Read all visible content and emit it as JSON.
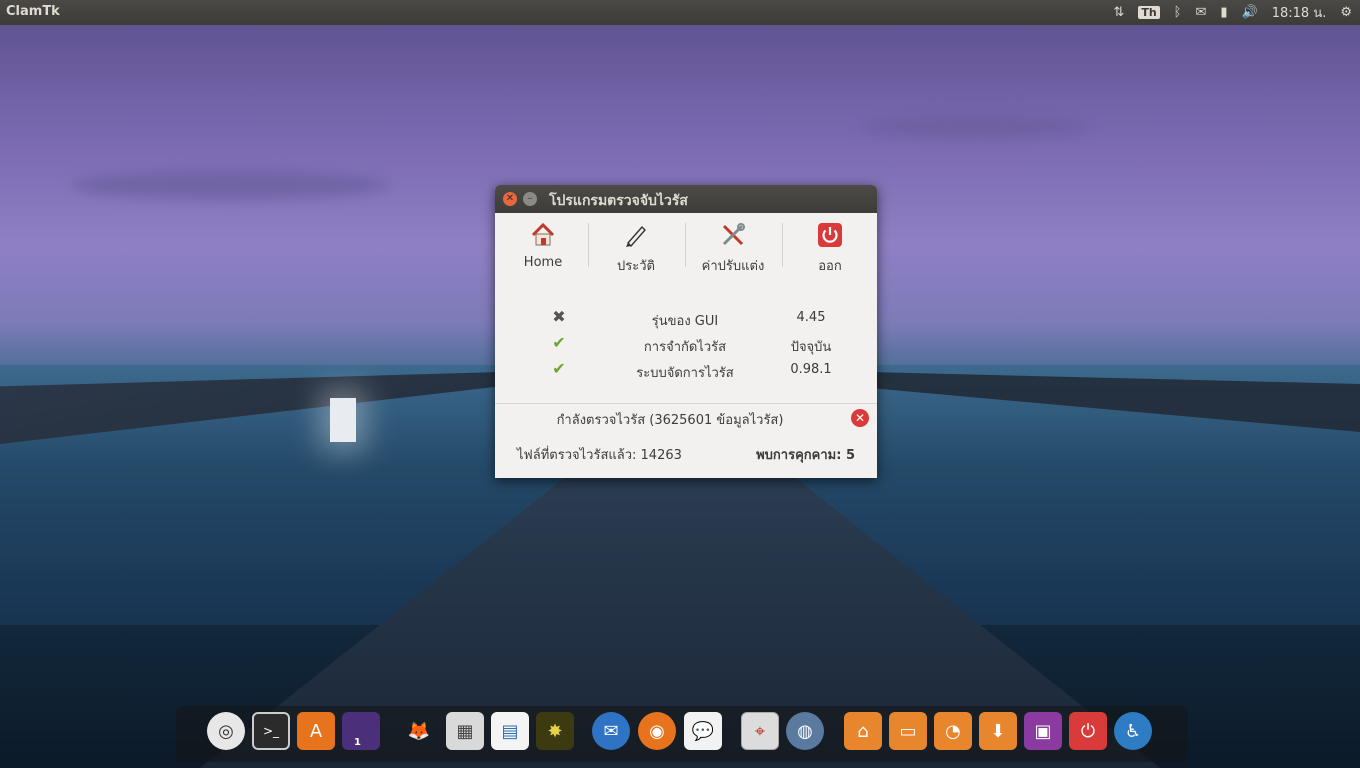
{
  "panel": {
    "app_title": "ClamTk",
    "keyboard": "Th",
    "clock": "18:18 น.",
    "icons": [
      "network-icon",
      "keyboard-icon",
      "bluetooth-icon",
      "mail-icon",
      "battery-icon",
      "volume-icon",
      "session-gear-icon"
    ]
  },
  "window": {
    "title": "โปรแกรมตรวจจับไวรัส",
    "toolbar": {
      "home": "Home",
      "history": "ประวัติ",
      "settings": "ค่าปรับแต่ง",
      "quit": "ออก"
    },
    "info": [
      {
        "status": "error",
        "name": "รุ่นของ GUI",
        "value": "4.45"
      },
      {
        "status": "ok",
        "name": "การจำกัดไวรัส",
        "value": "ปัจจุบัน"
      },
      {
        "status": "ok",
        "name": "ระบบจัดการไวรัส",
        "value": "0.98.1"
      }
    ],
    "scan_status": "กำลังตรวจไวรัส (3625601 ข้อมูลไวรัส)",
    "files_scanned": "ไฟล์ที่ตรวจไวรัสแล้ว: 14263",
    "threats_found": "พบการคุกคาม: 5"
  },
  "dock": {
    "workspace_badge": "1",
    "items": [
      "ubuntu-logo-icon",
      "terminal-icon",
      "software-center-icon",
      "workspace-switcher-icon",
      "gimp-icon",
      "calculator-icon",
      "writer-icon",
      "image-viewer-icon",
      "thunderbird-icon",
      "firefox-icon",
      "chat-icon",
      "clamtk-icon",
      "chromium-icon",
      "home-folder-icon",
      "documents-folder-icon",
      "recent-folder-icon",
      "downloads-folder-icon",
      "app-icon",
      "shutdown-icon",
      "accessibility-icon"
    ]
  },
  "colors": {
    "accent_orange": "#e9673f",
    "panel": "#3c3b37",
    "window_bg": "#f2f1f0"
  }
}
